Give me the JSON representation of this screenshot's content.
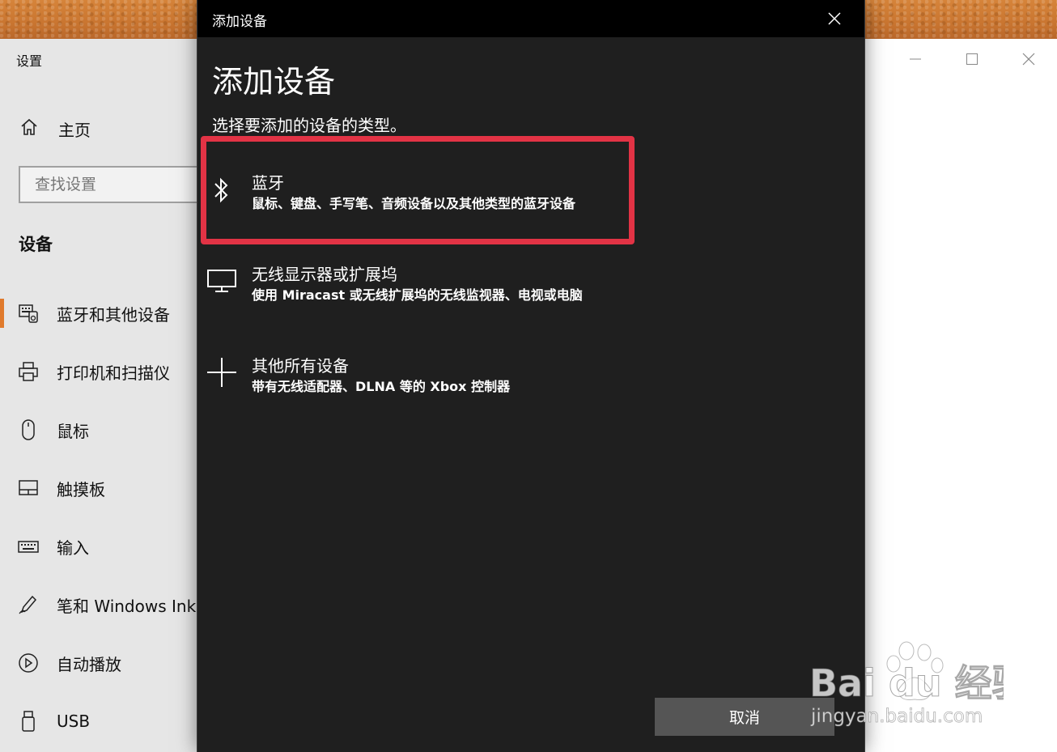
{
  "settings": {
    "title": "设置",
    "home_label": "主页",
    "search_placeholder": "查找设置",
    "section_heading": "设备",
    "nav_items": [
      {
        "label": "蓝牙和其他设备",
        "icon": "bluetooth-devices-icon",
        "active": true
      },
      {
        "label": "打印机和扫描仪",
        "icon": "printer-icon"
      },
      {
        "label": "鼠标",
        "icon": "mouse-icon"
      },
      {
        "label": "触摸板",
        "icon": "touchpad-icon"
      },
      {
        "label": "输入",
        "icon": "keyboard-icon"
      },
      {
        "label": "笔和 Windows Ink",
        "icon": "pen-icon"
      },
      {
        "label": "自动播放",
        "icon": "autoplay-icon"
      },
      {
        "label": "USB",
        "icon": "usb-icon"
      }
    ]
  },
  "dialog": {
    "titlebar": "添加设备",
    "heading": "添加设备",
    "subtitle": "选择要添加的设备的类型。",
    "options": [
      {
        "title": "蓝牙",
        "description": "鼠标、键盘、手写笔、音频设备以及其他类型的蓝牙设备",
        "icon": "bluetooth-icon"
      },
      {
        "title": "无线显示器或扩展坞",
        "description": "使用 Miracast 或无线扩展坞的无线监视器、电视或电脑",
        "icon": "monitor-icon"
      },
      {
        "title": "其他所有设备",
        "description": "带有无线适配器、DLNA 等的 Xbox 控制器",
        "icon": "plus-icon"
      }
    ],
    "cancel_label": "取消",
    "highlight_color": "#e23345"
  },
  "watermark": {
    "brand": "Bai du 经验",
    "url": "jingyan.baidu.com"
  }
}
